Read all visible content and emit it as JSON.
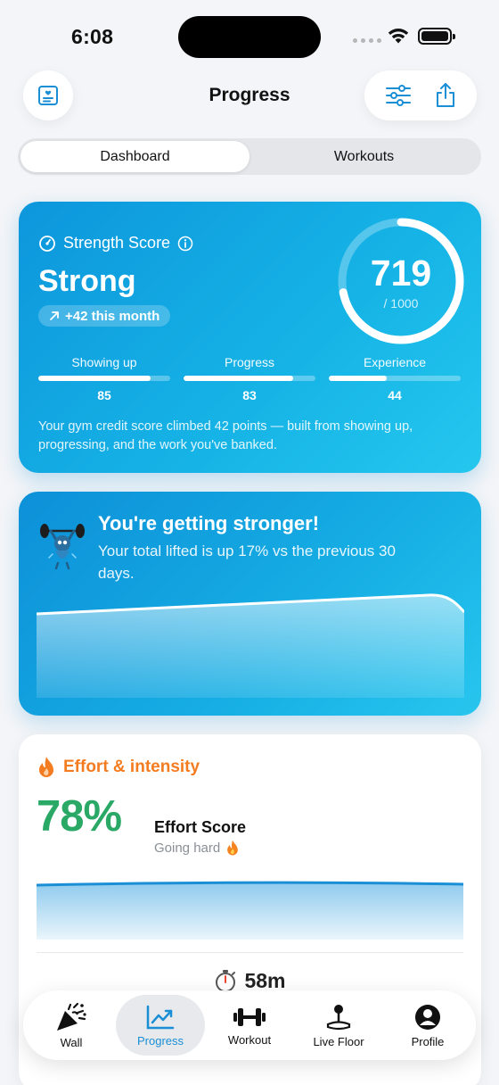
{
  "status_bar": {
    "time": "6:08"
  },
  "header": {
    "title": "Progress"
  },
  "segmented": {
    "tabs": [
      "Dashboard",
      "Workouts"
    ],
    "active": "Dashboard"
  },
  "strength_card": {
    "label": "Strength Score",
    "rating": "Strong",
    "delta": "+42 this month",
    "score": "719",
    "max": "/ 1000",
    "score_value": 719,
    "score_max": 1000,
    "metrics": [
      {
        "label": "Showing up",
        "value": "85",
        "fill": 0.85
      },
      {
        "label": "Progress",
        "value": "83",
        "fill": 0.83
      },
      {
        "label": "Experience",
        "value": "44",
        "fill": 0.44
      }
    ],
    "description": "Your gym credit score climbed 42 points — built from showing up, progressing, and the work you've banked."
  },
  "stronger_card": {
    "title": "You're getting stronger!",
    "subtitle": "Your total lifted is up 17% vs the previous 30 days."
  },
  "effort_card": {
    "title": "Effort & intensity",
    "percent": "78%",
    "label": "Effort Score",
    "status": "Going hard",
    "duration": "58m"
  },
  "tabbar": {
    "items": [
      {
        "label": "Wall",
        "icon": "party-popper-icon"
      },
      {
        "label": "Progress",
        "icon": "trending-chart-icon"
      },
      {
        "label": "Workout",
        "icon": "dumbbell-icon"
      },
      {
        "label": "Live Floor",
        "icon": "joystick-icon"
      },
      {
        "label": "Profile",
        "icon": "person-icon"
      }
    ],
    "active": "Progress"
  },
  "colors": {
    "accent": "#1a8fd6",
    "card_blue": "#16b4e6",
    "effort_orange": "#f47c20",
    "effort_green": "#2aa866"
  }
}
